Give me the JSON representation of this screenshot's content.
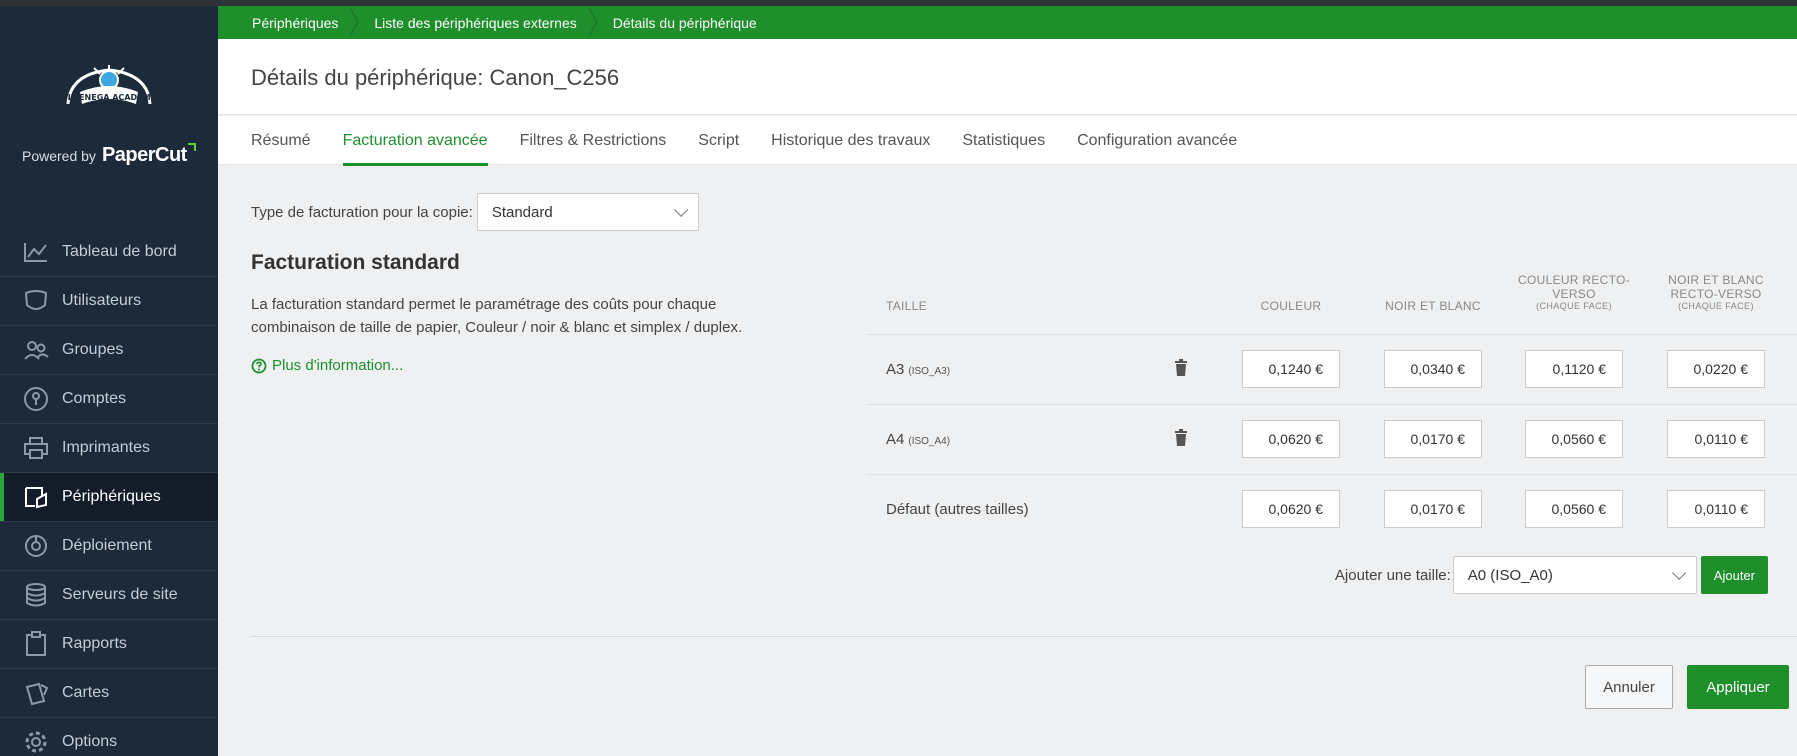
{
  "sidebar": {
    "logo_text": "BLUENEGA ACADEMY",
    "powered_by": "Powered by",
    "brand": "PaperCut",
    "items": [
      {
        "label": "Tableau de bord",
        "icon": "chart-line-icon"
      },
      {
        "label": "Utilisateurs",
        "icon": "user-icon"
      },
      {
        "label": "Groupes",
        "icon": "group-icon"
      },
      {
        "label": "Comptes",
        "icon": "account-icon"
      },
      {
        "label": "Imprimantes",
        "icon": "printer-icon"
      },
      {
        "label": "Périphériques",
        "icon": "device-icon",
        "active": true
      },
      {
        "label": "Déploiement",
        "icon": "deployment-icon"
      },
      {
        "label": "Serveurs de site",
        "icon": "database-icon"
      },
      {
        "label": "Rapports",
        "icon": "clipboard-icon"
      },
      {
        "label": "Cartes",
        "icon": "cards-icon"
      },
      {
        "label": "Options",
        "icon": "gear-icon"
      }
    ]
  },
  "breadcrumb": [
    "Périphériques",
    "Liste des périphériques externes",
    "Détails du périphérique"
  ],
  "header": {
    "title": "Détails du périphérique: Canon_C256"
  },
  "tabs": [
    {
      "label": "Résumé"
    },
    {
      "label": "Facturation avancée",
      "active": true
    },
    {
      "label": "Filtres & Restrictions"
    },
    {
      "label": "Script"
    },
    {
      "label": "Historique des travaux"
    },
    {
      "label": "Statistiques"
    },
    {
      "label": "Configuration avancée"
    }
  ],
  "billing": {
    "type_label": "Type de facturation pour la copie:",
    "type_value": "Standard",
    "section_title": "Facturation standard",
    "description": "La facturation standard permet le paramétrage des coûts pour chaque combinaison de taille de papier, Couleur / noir & blanc et simplex / duplex.",
    "more_info": "Plus d'information..."
  },
  "table": {
    "headers": {
      "size": "TAILLE",
      "color": "COULEUR",
      "bw": "NOIR ET BLANC",
      "color_duplex": "COULEUR RECTO-VERSO",
      "color_duplex_sub": "(CHAQUE FACE)",
      "bw_duplex": "NOIR ET BLANC RECTO-VERSO",
      "bw_duplex_sub": "(CHAQUE FACE)"
    },
    "rows": [
      {
        "size": "A3",
        "code": "(ISO_A3)",
        "color": "0,1240 €",
        "bw": "0,0340 €",
        "color_duplex": "0,1120 €",
        "bw_duplex": "0,0220 €"
      },
      {
        "size": "A4",
        "code": "(ISO_A4)",
        "color": "0,0620 €",
        "bw": "0,0170 €",
        "color_duplex": "0,0560 €",
        "bw_duplex": "0,0110 €"
      },
      {
        "size": "Défaut (autres tailles)",
        "code": "",
        "color": "0,0620 €",
        "bw": "0,0170 €",
        "color_duplex": "0,0560 €",
        "bw_duplex": "0,0110 €"
      }
    ]
  },
  "add_size": {
    "label": "Ajouter une taille:",
    "value": "A0 (ISO_A0)",
    "button": "Ajouter"
  },
  "actions": {
    "cancel": "Annuler",
    "apply": "Appliquer"
  },
  "colors": {
    "accent": "#1f8f2c",
    "sidebar_bg": "#1c2a3a"
  }
}
